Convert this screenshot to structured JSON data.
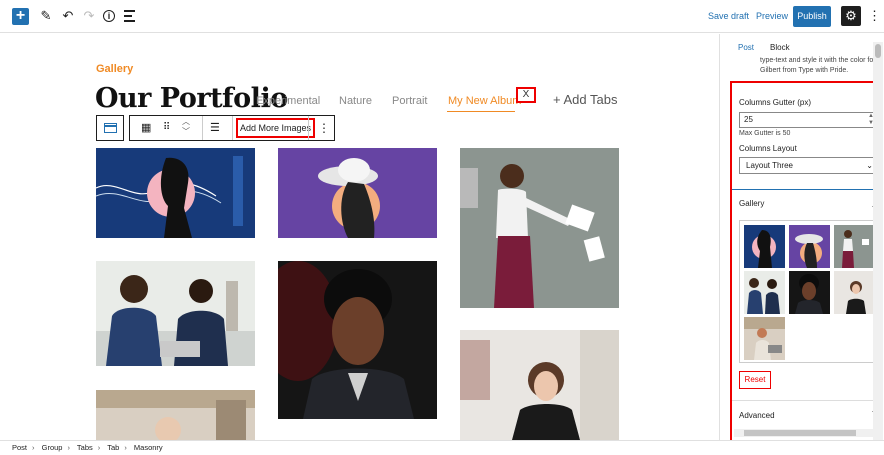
{
  "toolbar": {
    "save_draft": "Save draft",
    "preview": "Preview",
    "publish": "Publish",
    "icons": [
      "plus-icon",
      "pencil-icon",
      "undo-icon",
      "redo-icon",
      "info-icon",
      "list-view-icon",
      "gear-icon",
      "more-vertical-icon"
    ],
    "accent": "#2271b1"
  },
  "canvas": {
    "section_label": "Gallery",
    "title": "Our Portfolio",
    "tabs": [
      {
        "label": "Experimental"
      },
      {
        "label": "Nature"
      },
      {
        "label": "Portrait"
      },
      {
        "label": "My New Album"
      }
    ],
    "active_tab": "My New Album",
    "close_tab": "X",
    "add_tabs": "+ Add Tabs",
    "add_more_images": "Add More Images",
    "accent_color": "#f08a24"
  },
  "sidebar": {
    "tabs": {
      "post": "Post",
      "block": "Block"
    },
    "active_tab": "Post",
    "clipped_text": "type-text and style it with the color font Gilbert from Type with Pride.",
    "columns_gutter_label": "Columns Gutter (px)",
    "columns_gutter_value": "25",
    "max_gutter_help": "Max Gutter is 50",
    "columns_layout_label": "Columns Layout",
    "columns_layout_value": "Layout Three",
    "gallery_panel": "Gallery",
    "reset": "Reset",
    "advanced_panel": "Advanced"
  },
  "breadcrumb": [
    "Post",
    "Group",
    "Tabs",
    "Tab",
    "Masonry"
  ]
}
